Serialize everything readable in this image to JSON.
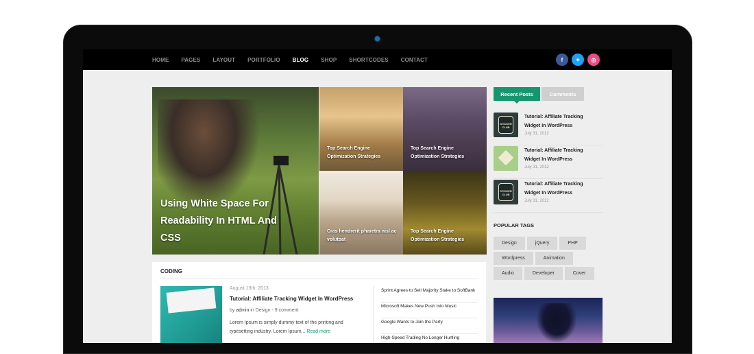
{
  "nav": {
    "items": [
      {
        "label": "HOME",
        "active": false
      },
      {
        "label": "PAGES",
        "active": false
      },
      {
        "label": "LAYOUT",
        "active": false
      },
      {
        "label": "PORTFOLIO",
        "active": false
      },
      {
        "label": "BLOG",
        "active": true
      },
      {
        "label": "SHOP",
        "active": false
      },
      {
        "label": "SHORTCODES",
        "active": false
      },
      {
        "label": "CONTACT",
        "active": false
      }
    ],
    "socials": [
      {
        "icon": "facebook-icon",
        "glyph": "f",
        "color": "#3b5998"
      },
      {
        "icon": "twitter-icon",
        "glyph": "✦",
        "color": "#1da1f2"
      },
      {
        "icon": "dribbble-icon",
        "glyph": "◎",
        "color": "#ea4c89"
      }
    ]
  },
  "featured": {
    "main": {
      "title": "Using White Space For Readability In HTML And CSS"
    },
    "small": [
      {
        "caption": "Top Search Engine Optimization Strategies"
      },
      {
        "caption": "Top Search Engine Optimization Strategies"
      },
      {
        "caption": "Cras hendrerit pharetra nisl ac volutpat"
      },
      {
        "caption": "Top Search Engine Optimization Strategies"
      }
    ]
  },
  "coding": {
    "section_title": "CODING",
    "post": {
      "date": "August 13th, 2013",
      "title": "Tutorial: Affiliate Tracking Widget In WordPress",
      "meta_by": "by ",
      "author": "admin",
      "meta_in": " in ",
      "category": "Design",
      "meta_sep": " - ",
      "comments": "9 comment",
      "excerpt": "Lorem Ipsum is simply dummy text of the printing and typesetting industry. Lorem Ipsum...",
      "read_more": "Read more"
    },
    "news": [
      "Sprint Agrees to Sell Majority Stake to SoftBank",
      "Microsoft Makes New Push Into Music",
      "Google Wants to Join the Party",
      "High-Speed Trading No Longer Hurtling"
    ]
  },
  "sidebar": {
    "tabs": {
      "recent": "Recent Posts",
      "comments": "Comments"
    },
    "recent_posts": [
      {
        "title": "Tutorial: Affiliate Tracking Widget In WordPress",
        "date": "July 31, 2012",
        "thumb": "dark",
        "thumb_text": "STICKER CLUB"
      },
      {
        "title": "Tutorial: Affiliate Tracking Widget In WordPress",
        "date": "July 31, 2012",
        "thumb": "green",
        "thumb_text": ""
      },
      {
        "title": "Tutorial: Affiliate Tracking Widget In WordPress",
        "date": "July 31, 2012",
        "thumb": "dark",
        "thumb_text": "STICKER CLUB"
      }
    ],
    "tags_title": "POPULAR TAGS",
    "tags": [
      "Design",
      "jQuery",
      "PHP",
      "Wordpress",
      "Animation",
      "Audio",
      "Developer",
      "Cover"
    ]
  },
  "colors": {
    "accent": "#15966e",
    "nav_bg": "#000000",
    "page_bg": "#eeeeee"
  }
}
